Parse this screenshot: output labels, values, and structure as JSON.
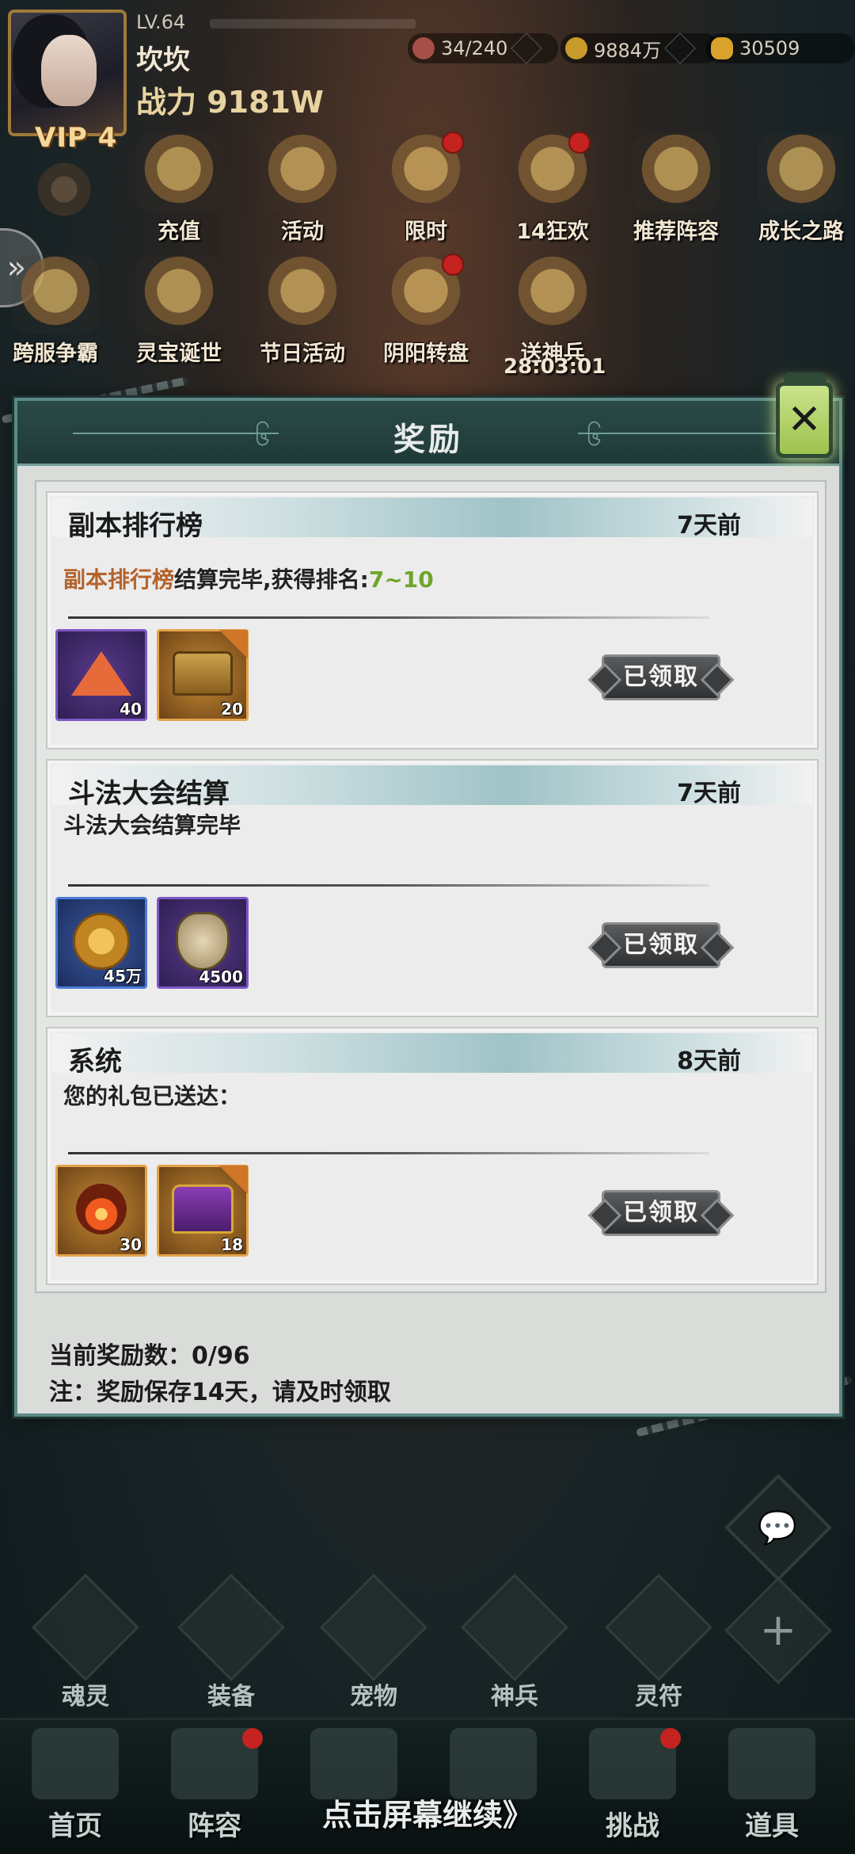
{
  "player": {
    "level": "LV.64",
    "name": "坎坎",
    "power": "战力 9181W",
    "vip": "VIP 4"
  },
  "resources": [
    {
      "icon": "stamina-icon",
      "value": "34/240"
    },
    {
      "icon": "copper-coin-icon",
      "value": "9884万"
    },
    {
      "icon": "gold-ingot-icon",
      "value": "30509"
    }
  ],
  "activities_row1": [
    {
      "label": "充值",
      "icon": "recharge-icon",
      "badge": false
    },
    {
      "label": "活动",
      "icon": "event-icon",
      "badge": false
    },
    {
      "label": "限时",
      "icon": "limited-time-icon",
      "badge": true
    },
    {
      "label": "14狂欢",
      "icon": "carnival-gift-icon",
      "badge": true
    },
    {
      "label": "推荐阵容",
      "icon": "recommended-lineup-icon",
      "badge": false
    },
    {
      "label": "成长之路",
      "icon": "growth-path-icon",
      "badge": false
    }
  ],
  "activities_row2": [
    {
      "label": "跨服争霸",
      "icon": "cross-server-icon",
      "badge": false
    },
    {
      "label": "灵宝诞世",
      "icon": "spirit-treasure-icon",
      "badge": false
    },
    {
      "label": "节日活动",
      "icon": "festival-icon",
      "badge": false
    },
    {
      "label": "阴阳转盘",
      "icon": "yin-yang-wheel-icon",
      "badge": true
    },
    {
      "label": "送神兵",
      "icon": "divine-weapon-icon",
      "badge": false
    }
  ],
  "timer": "28:03:01",
  "dialog": {
    "title": "奖励",
    "close_icon": "close-icon",
    "rewards": [
      {
        "title": "副本排行榜",
        "time": "7天前",
        "message_parts": [
          "副本排行榜",
          "结算完毕,获得排名:",
          "7~10"
        ],
        "items": [
          {
            "icon": "pyramid-crystal-icon",
            "count": "40",
            "rarity": "purple"
          },
          {
            "icon": "golden-chest-icon",
            "count": "20",
            "rarity": "orange"
          }
        ],
        "button": "已领取"
      },
      {
        "title": "斗法大会结算",
        "time": "7天前",
        "message_parts": [
          "",
          "斗法大会结算完毕",
          ""
        ],
        "items": [
          {
            "icon": "copper-coin-icon",
            "count": "45万",
            "rarity": "blue"
          },
          {
            "icon": "crest-shield-icon",
            "count": "4500",
            "rarity": "purple"
          }
        ],
        "button": "已领取"
      },
      {
        "title": "系统",
        "time": "8天前",
        "message_parts": [
          "",
          "您的礼包已送达：",
          ""
        ],
        "items": [
          {
            "icon": "fire-orb-icon",
            "count": "30",
            "rarity": "orange"
          },
          {
            "icon": "purple-chest-icon",
            "count": "18",
            "rarity": "orange"
          }
        ],
        "button": "已领取"
      }
    ],
    "count_text": "当前奖励数：0/96",
    "note_text": "注：奖励保存14天，请及时领取"
  },
  "functions": [
    "魂灵",
    "装备",
    "宠物",
    "神兵",
    "灵符"
  ],
  "nav": [
    {
      "label": "首页",
      "badge": false
    },
    {
      "label": "阵容",
      "badge": true
    },
    {
      "label": "",
      "badge": false
    },
    {
      "label": "",
      "badge": false
    },
    {
      "label": "挑战",
      "badge": true
    },
    {
      "label": "道具",
      "badge": false
    }
  ],
  "continue_text": "点击屏幕继续》"
}
